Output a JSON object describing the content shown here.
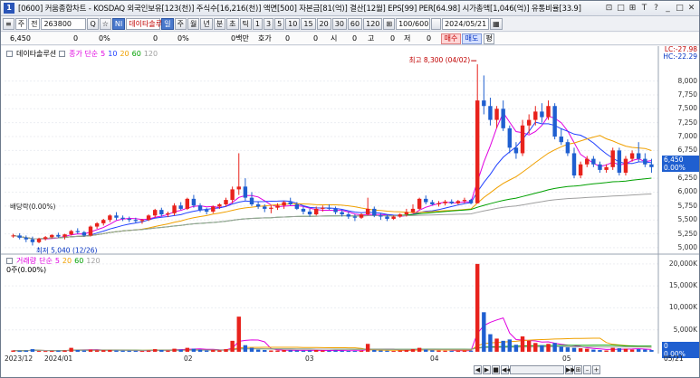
{
  "titlebar": {
    "icon_label": "1",
    "text": "[0600] 커움종합차트 - KOSDAQ 외국인보유[123(천)] 주식수[16,216(천)] 액면[500] 자본금[81(억)] 결산[12월] EPS[99] PER[64.98] 시가총액[1,046(억)] 유통비율[33.9]",
    "buttons": [
      "⊡",
      "□",
      "⊞",
      "T",
      "?",
      "_",
      "□",
      "✕"
    ]
  },
  "toolbar": {
    "menu_icon": "≡",
    "period_type": "주",
    "compare": "전",
    "stock_code": "263800",
    "search_icon": "Q",
    "star_icon": "☆",
    "brand_badge": "NI",
    "stock_name": "데이타솔루",
    "period_buttons": [
      "일",
      "주",
      "월",
      "년",
      "분",
      "초",
      "틱"
    ],
    "selected_period": "일",
    "intervals": [
      "1",
      "3",
      "5",
      "10",
      "15",
      "20",
      "30",
      "60",
      "120"
    ],
    "extra_icon": "⊞",
    "count": "100/600",
    "date": "2024/05/21",
    "calendar_icon": "▦"
  },
  "infobar": {
    "price": "6,450",
    "change": "0",
    "pct": "0%",
    "vol": "0",
    "vol_pct": "0%",
    "amount": "0백만",
    "ask_label": "호가",
    "ask": "0",
    "open_val": "0",
    "open_label": "시",
    "high_val": "0",
    "high_label": "고",
    "low_val": "0",
    "low_label": "저",
    "close_val": "0",
    "buy": "매수",
    "sell": "매도",
    "pin": "평"
  },
  "price_legend": {
    "name": "데이타솔루션",
    "ma_label": "종가 단순",
    "ma": [
      {
        "period": "5",
        "color": "#e000e0"
      },
      {
        "period": "10",
        "color": "#2040ff"
      },
      {
        "period": "20",
        "color": "#f0a000"
      },
      {
        "period": "60",
        "color": "#00a000"
      },
      {
        "period": "120",
        "color": "#a0a0a0"
      }
    ]
  },
  "volume_legend": {
    "name": "거래량",
    "ma_label": "단순",
    "ma": [
      {
        "period": "5",
        "color": "#e000e0"
      },
      {
        "period": "20",
        "color": "#f0a000"
      },
      {
        "period": "60",
        "color": "#00a000"
      },
      {
        "period": "120",
        "color": "#a0a0a0"
      }
    ],
    "current": "0주(0.00%)"
  },
  "annotations": {
    "high": "최고 8,300 (04/02)",
    "low": "최저 5,040 (12/26)",
    "dividend": "배당락(0.00%)",
    "lc": "LC:-27.98",
    "hc": "HC:-22.29"
  },
  "price_axis": [
    "8,000",
    "7,750",
    "7,500",
    "7,250",
    "7,000",
    "6,750",
    "6,500",
    "6,250",
    "6,000",
    "5,750",
    "5,500",
    "5,250",
    "5,000"
  ],
  "volume_axis": [
    "20,000K",
    "15,000K",
    "10,000K",
    "5,000K"
  ],
  "last_price_badge": "6,450",
  "last_pct_badge": "0.00%",
  "vol_badge": "0",
  "vol_pct_badge": "0.00%",
  "x_axis": [
    "2023/12",
    "2024/01",
    "02",
    "03",
    "04",
    "05",
    "05/21"
  ],
  "colors": {
    "up": "#e8221c",
    "down": "#1f5fd0",
    "accent": "#1f5fd0"
  },
  "scroll_buttons": [
    "◀",
    "▶",
    "■",
    "◀◀",
    "▶▶",
    "⊞",
    "–",
    "+"
  ],
  "chart_data": {
    "type": "candlestick",
    "price_range": [
      4950,
      8400
    ],
    "volume_range": [
      0,
      21000
    ],
    "candles": [
      [
        5210,
        5250,
        5180,
        5220,
        300
      ],
      [
        5220,
        5260,
        5150,
        5180,
        250
      ],
      [
        5180,
        5220,
        5100,
        5150,
        280
      ],
      [
        5150,
        5200,
        5040,
        5100,
        600
      ],
      [
        5100,
        5180,
        5080,
        5160,
        200
      ],
      [
        5160,
        5210,
        5130,
        5190,
        180
      ],
      [
        5190,
        5240,
        5170,
        5230,
        220
      ],
      [
        5230,
        5270,
        5180,
        5200,
        260
      ],
      [
        5200,
        5250,
        5150,
        5240,
        300
      ],
      [
        5240,
        5320,
        5220,
        5300,
        900
      ],
      [
        5300,
        5350,
        5250,
        5280,
        400
      ],
      [
        5280,
        5300,
        5200,
        5220,
        300
      ],
      [
        5220,
        5400,
        5200,
        5380,
        500
      ],
      [
        5380,
        5460,
        5340,
        5440,
        350
      ],
      [
        5440,
        5520,
        5400,
        5500,
        380
      ],
      [
        5500,
        5600,
        5460,
        5580,
        420
      ],
      [
        5580,
        5640,
        5500,
        5540,
        300
      ],
      [
        5540,
        5580,
        5480,
        5520,
        260
      ],
      [
        5520,
        5560,
        5460,
        5500,
        240
      ],
      [
        5500,
        5540,
        5440,
        5480,
        220
      ],
      [
        5480,
        5520,
        5430,
        5500,
        200
      ],
      [
        5500,
        5600,
        5480,
        5580,
        300
      ],
      [
        5580,
        5700,
        5540,
        5680,
        600
      ],
      [
        5680,
        5720,
        5560,
        5600,
        400
      ],
      [
        5600,
        5650,
        5550,
        5620,
        300
      ],
      [
        5620,
        5800,
        5580,
        5760,
        700
      ],
      [
        5760,
        5820,
        5680,
        5700,
        500
      ],
      [
        5700,
        5900,
        5680,
        5880,
        900
      ],
      [
        5880,
        5950,
        5720,
        5760,
        700
      ],
      [
        5760,
        5800,
        5640,
        5680,
        500
      ],
      [
        5680,
        5720,
        5600,
        5650,
        300
      ],
      [
        5650,
        5760,
        5620,
        5740,
        400
      ],
      [
        5740,
        5800,
        5700,
        5780,
        350
      ],
      [
        5780,
        5900,
        5740,
        5860,
        600
      ],
      [
        5860,
        6100,
        5800,
        6050,
        2500
      ],
      [
        6050,
        6700,
        5950,
        6100,
        8000
      ],
      [
        6100,
        6250,
        5850,
        5900,
        1500
      ],
      [
        5900,
        6000,
        5750,
        5780,
        900
      ],
      [
        5780,
        5820,
        5700,
        5740,
        500
      ],
      [
        5740,
        5780,
        5640,
        5700,
        400
      ],
      [
        5700,
        5760,
        5620,
        5720,
        300
      ],
      [
        5720,
        5800,
        5680,
        5760,
        300
      ],
      [
        5760,
        5840,
        5700,
        5820,
        400
      ],
      [
        5820,
        5900,
        5760,
        5780,
        350
      ],
      [
        5780,
        5820,
        5680,
        5700,
        300
      ],
      [
        5700,
        5740,
        5600,
        5650,
        250
      ],
      [
        5650,
        5700,
        5560,
        5600,
        300
      ],
      [
        5600,
        5740,
        5580,
        5700,
        400
      ],
      [
        5700,
        5760,
        5650,
        5720,
        300
      ],
      [
        5720,
        5780,
        5680,
        5700,
        250
      ],
      [
        5700,
        5740,
        5600,
        5640,
        300
      ],
      [
        5640,
        5680,
        5560,
        5600,
        250
      ],
      [
        5600,
        5640,
        5520,
        5560,
        220
      ],
      [
        5560,
        5600,
        5480,
        5540,
        200
      ],
      [
        5540,
        5620,
        5520,
        5600,
        250
      ],
      [
        5600,
        5900,
        5580,
        5700,
        1800
      ],
      [
        5700,
        5740,
        5550,
        5580,
        400
      ],
      [
        5580,
        5620,
        5500,
        5560,
        300
      ],
      [
        5560,
        5600,
        5480,
        5520,
        250
      ],
      [
        5520,
        5580,
        5500,
        5560,
        200
      ],
      [
        5560,
        5620,
        5540,
        5600,
        300
      ],
      [
        5600,
        5700,
        5560,
        5640,
        400
      ],
      [
        5640,
        5780,
        5620,
        5700,
        600
      ],
      [
        5700,
        5900,
        5680,
        5880,
        900
      ],
      [
        5880,
        5940,
        5780,
        5820,
        500
      ],
      [
        5820,
        5860,
        5760,
        5780,
        350
      ],
      [
        5780,
        5840,
        5740,
        5800,
        300
      ],
      [
        5800,
        5860,
        5760,
        5830,
        250
      ],
      [
        5830,
        5870,
        5780,
        5800,
        220
      ],
      [
        5800,
        5860,
        5780,
        5840,
        250
      ],
      [
        5840,
        5900,
        5800,
        5860,
        300
      ],
      [
        5860,
        5880,
        5780,
        5800,
        280
      ],
      [
        5800,
        8300,
        5800,
        7650,
        20000
      ],
      [
        7650,
        8100,
        7400,
        7550,
        9000
      ],
      [
        7550,
        7700,
        7200,
        7300,
        4000
      ],
      [
        7300,
        7550,
        7150,
        7500,
        3000
      ],
      [
        7500,
        7650,
        7100,
        7150,
        2500
      ],
      [
        7150,
        7200,
        6700,
        6800,
        2800
      ],
      [
        6800,
        6900,
        6600,
        6700,
        1600
      ],
      [
        6700,
        7300,
        6650,
        7200,
        3500
      ],
      [
        7200,
        7400,
        7050,
        7300,
        2500
      ],
      [
        7300,
        7550,
        7200,
        7450,
        2000
      ],
      [
        7450,
        7600,
        7250,
        7350,
        1500
      ],
      [
        7350,
        7650,
        7300,
        7550,
        1800
      ],
      [
        7550,
        7600,
        6950,
        7000,
        2000
      ],
      [
        7000,
        7150,
        6850,
        6900,
        1200
      ],
      [
        6900,
        6950,
        6650,
        6700,
        1000
      ],
      [
        6700,
        6800,
        6250,
        6300,
        900
      ],
      [
        6300,
        6550,
        6250,
        6500,
        800
      ],
      [
        6500,
        6650,
        6450,
        6600,
        700
      ],
      [
        6600,
        6650,
        6450,
        6500,
        500
      ],
      [
        6500,
        6550,
        6350,
        6400,
        400
      ],
      [
        6400,
        6500,
        6350,
        6450,
        300
      ],
      [
        6450,
        6800,
        6400,
        6750,
        900
      ],
      [
        6750,
        6800,
        6300,
        6350,
        800
      ],
      [
        6350,
        6650,
        6300,
        6600,
        700
      ],
      [
        6600,
        6750,
        6550,
        6700,
        500
      ],
      [
        6700,
        6900,
        6550,
        6600,
        600
      ],
      [
        6600,
        6700,
        6450,
        6500,
        500
      ],
      [
        6500,
        6600,
        6350,
        6450,
        400
      ]
    ]
  }
}
